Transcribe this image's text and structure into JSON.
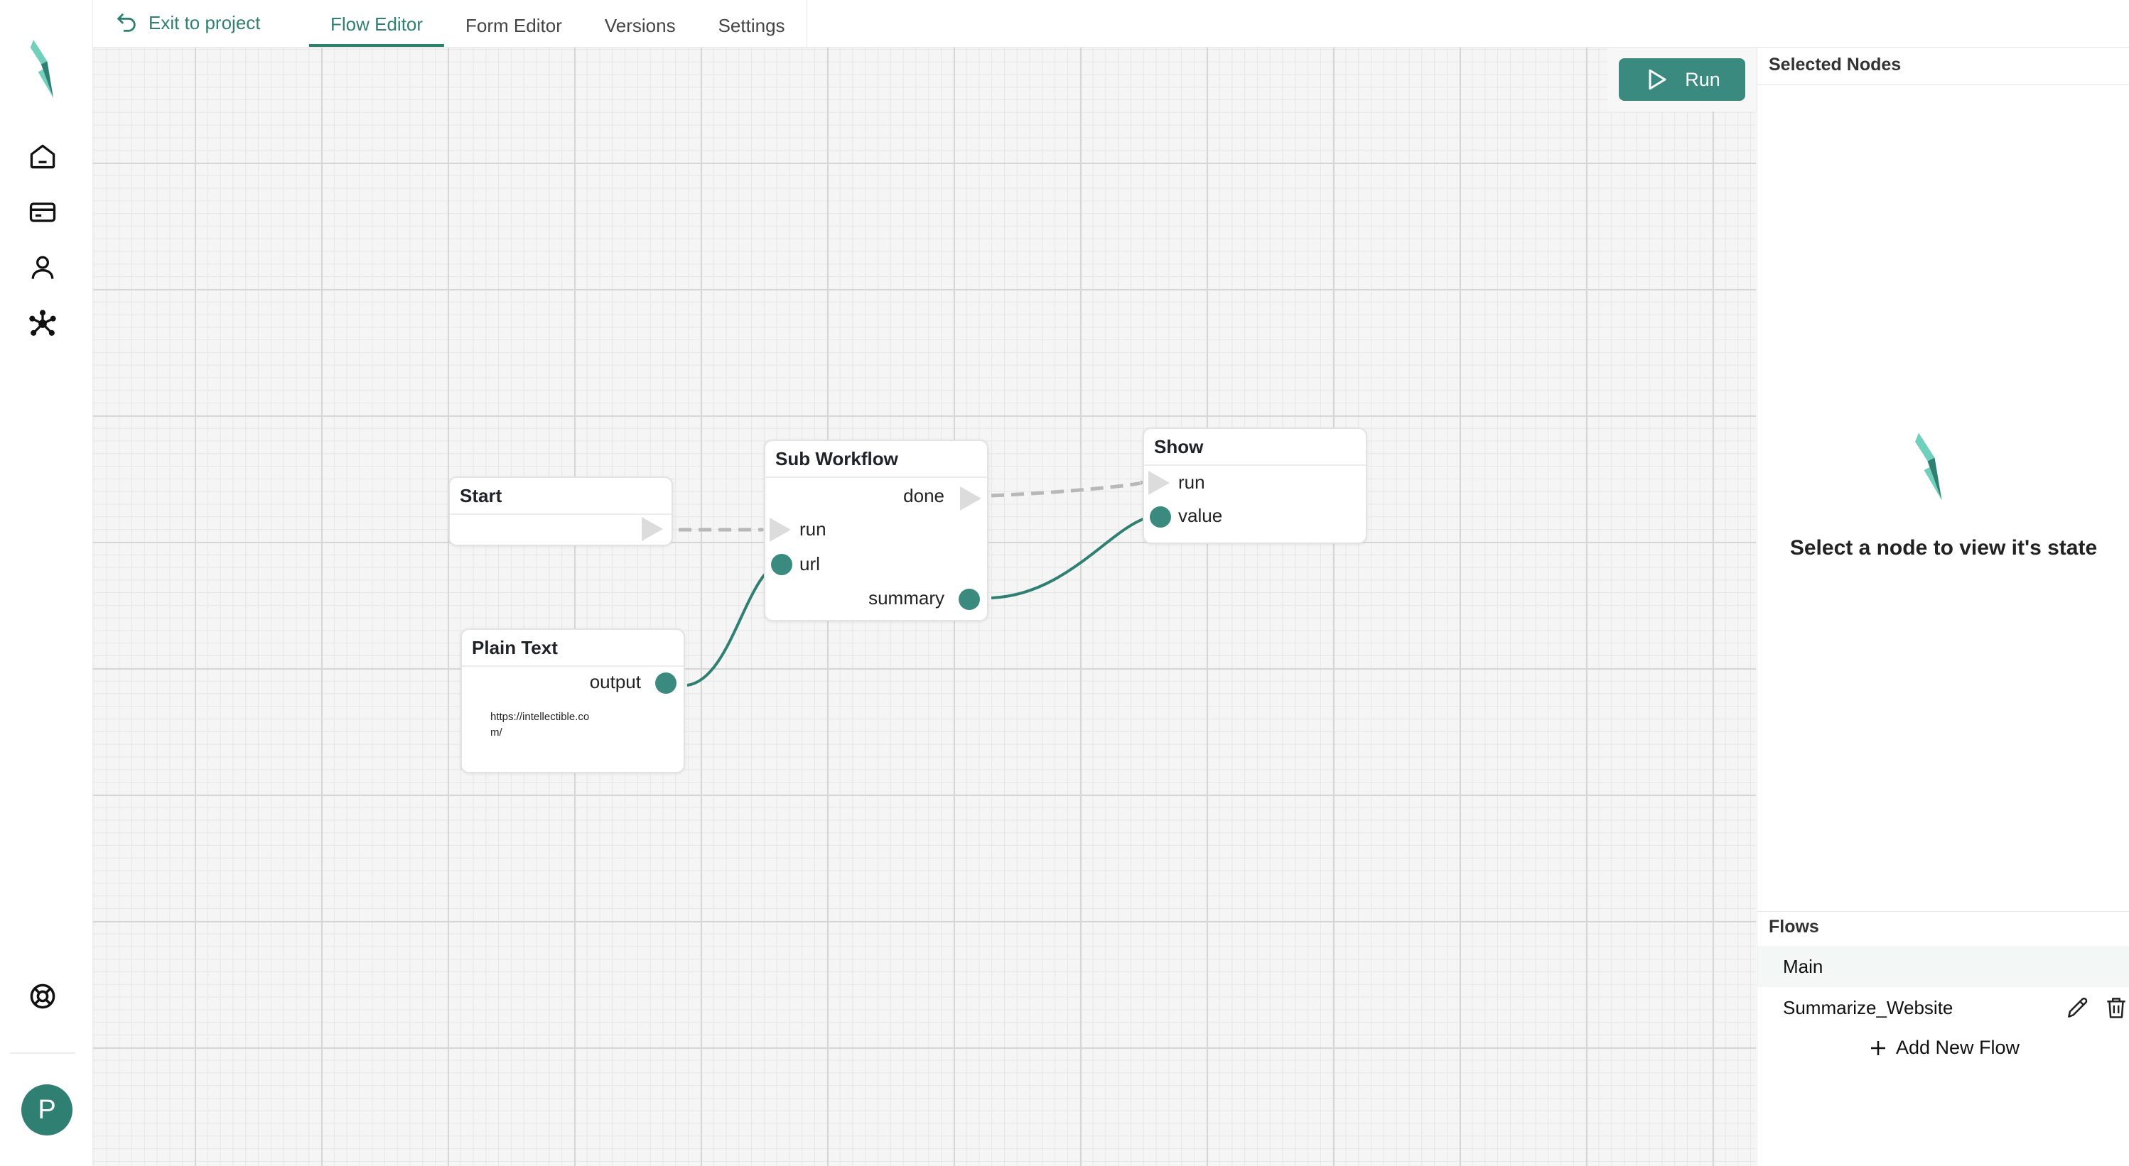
{
  "topbar": {
    "exit_label": "Exit to project",
    "tabs": [
      {
        "label": "Flow Editor",
        "active": true
      },
      {
        "label": "Form Editor",
        "active": false
      },
      {
        "label": "Versions",
        "active": false
      },
      {
        "label": "Settings",
        "active": false
      }
    ]
  },
  "sidebar": {
    "icons": [
      "logo-icon",
      "home-icon",
      "card-icon",
      "user-icon",
      "network-icon",
      "help-lifebuoy-icon"
    ],
    "avatar_letter": "P"
  },
  "toolbar": {
    "run_label": "Run"
  },
  "nodes": {
    "start": {
      "title": "Start"
    },
    "sub_workflow": {
      "title": "Sub Workflow",
      "out_done": "done",
      "in_run": "run",
      "in_url": "url",
      "out_summary": "summary"
    },
    "show": {
      "title": "Show",
      "in_run": "run",
      "in_value": "value"
    },
    "plain_text": {
      "title": "Plain Text",
      "out_output": "output",
      "text": "https://intellectible.com/"
    }
  },
  "right_panel": {
    "selected_title": "Selected Nodes",
    "empty_message": "Select a node to view it's state",
    "flows_title": "Flows",
    "flows": [
      {
        "name": "Main",
        "active": true
      },
      {
        "name": "Summarize_Website",
        "active": false
      }
    ],
    "add_flow_label": "Add New Flow"
  },
  "colors": {
    "accent": "#3b8a7f",
    "brand_light": "#6fd1bb",
    "canvas_bg": "#f5f5f5"
  }
}
